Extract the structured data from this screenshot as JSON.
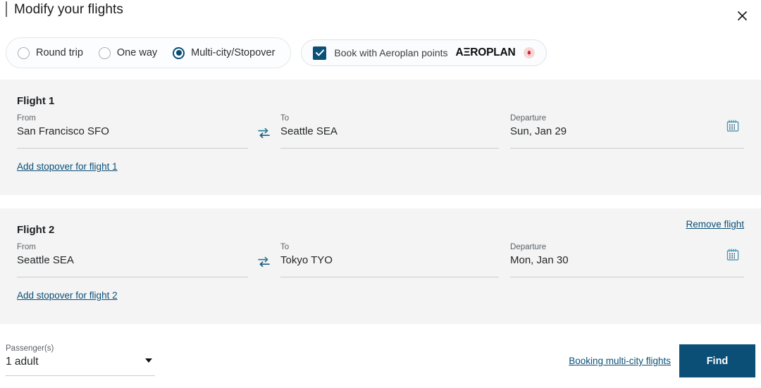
{
  "header": {
    "title": "Modify your flights",
    "close_icon": "close-icon"
  },
  "trip_types": {
    "options": [
      {
        "label": "Round trip",
        "selected": false
      },
      {
        "label": "One way",
        "selected": false
      },
      {
        "label": "Multi-city/Stopover",
        "selected": true
      }
    ]
  },
  "aeroplan": {
    "checked": true,
    "label": "Book with Aeroplan points",
    "logo_text": "AΞROPLAN",
    "leaf_icon": "maple-leaf-icon",
    "leaf_color": "#d6121f",
    "leaf_bg": "#f7d7d7"
  },
  "flights": [
    {
      "title": "Flight 1",
      "from_label": "From",
      "from_value": "San Francisco SFO",
      "to_label": "To",
      "to_value": "Seattle SEA",
      "departure_label": "Departure",
      "departure_value": "Sun, Jan 29",
      "stopover_link": "Add stopover for flight 1",
      "remove_link": "",
      "swap_icon": "swap-arrows-icon",
      "calendar_icon": "calendar-icon"
    },
    {
      "title": "Flight 2",
      "from_label": "From",
      "from_value": "Seattle SEA",
      "to_label": "To",
      "to_value": "Tokyo TYO",
      "departure_label": "Departure",
      "departure_value": "Mon, Jan 30",
      "stopover_link": "Add stopover for flight 2",
      "remove_link": "Remove flight",
      "swap_icon": "swap-arrows-icon",
      "calendar_icon": "calendar-icon"
    }
  ],
  "footer": {
    "passengers_label": "Passenger(s)",
    "passengers_value": "1 adult",
    "caret_icon": "chevron-down-icon",
    "booking_link": "Booking multi-city flights",
    "find_label": "Find"
  },
  "colors": {
    "accent_link": "#0a4f78",
    "button_bg": "#0b4f77",
    "panel_bg": "#f4f4f4",
    "icon_teal": "#2d7d9a"
  }
}
